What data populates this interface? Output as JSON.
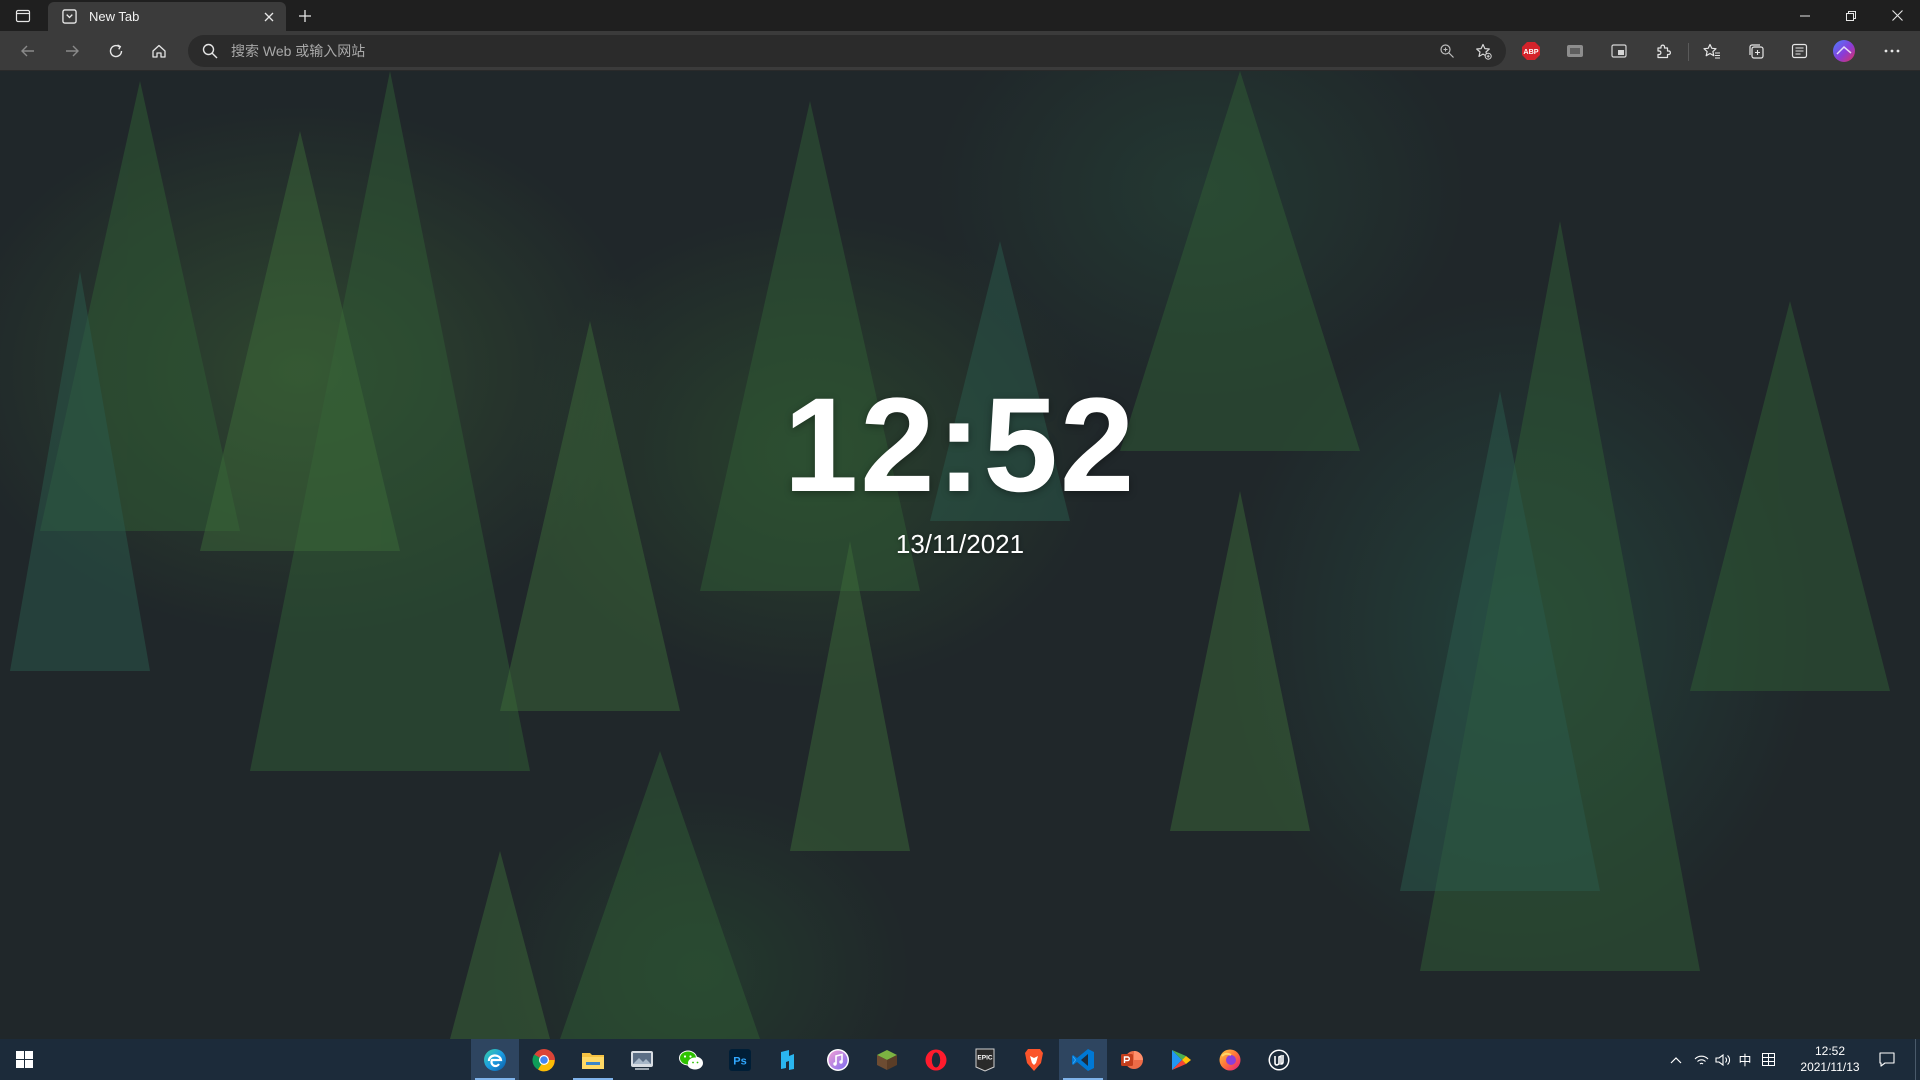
{
  "tab": {
    "title": "New Tab"
  },
  "omnibox": {
    "placeholder": "搜索 Web 或输入网站"
  },
  "extensions": {
    "abp_label": "ABP"
  },
  "page": {
    "time": "12:52",
    "date": "13/11/2021"
  },
  "taskbar": {
    "apps": [
      "edge-icon",
      "chrome-icon",
      "file-explorer-icon",
      "photos-icon",
      "wechat-icon",
      "photoshop-icon",
      "app-n-icon",
      "itunes-icon",
      "minecraft-icon",
      "opera-icon",
      "epic-games-icon",
      "brave-icon",
      "vscode-icon",
      "powerpoint-icon",
      "play-store-icon",
      "firefox-icon",
      "unreal-engine-icon"
    ],
    "ps_label": "Ps",
    "epic_label": "EPIC",
    "ime": "中",
    "time": "12:52",
    "date": "2021/11/13"
  },
  "colors": {
    "taskbar": "#1c2b3a",
    "accent": "#7fb3ea",
    "tab_bg": "#3b3b3b"
  }
}
